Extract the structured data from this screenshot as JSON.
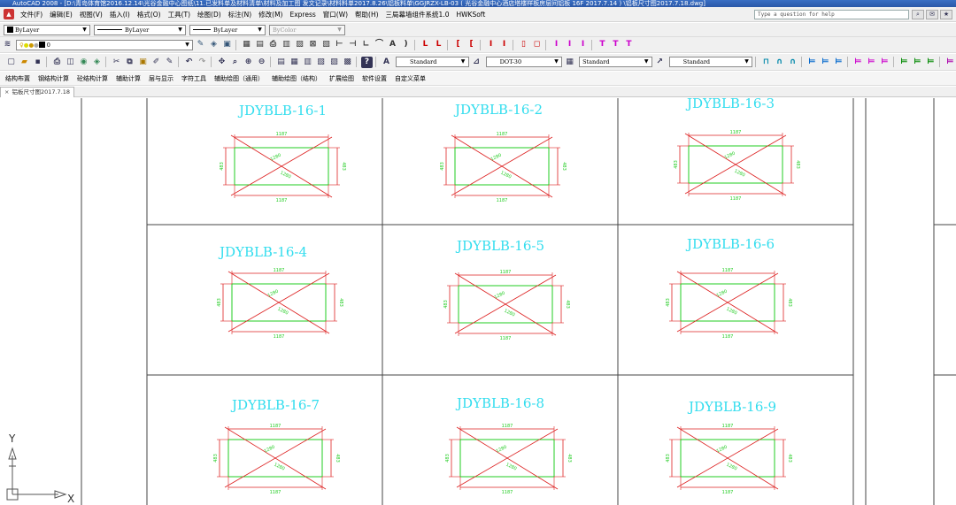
{
  "window": {
    "title": "AutoCAD 2008 - [D:\\青岛体育馆2016.12.14\\光谷金融中心图纸\\11.已发料单及材料清单\\材料及加工图 发文记录\\材料料单2017.8.26\\铝板料单\\GGJRZX-LB-03 ( 光谷金融中心酒店塔楼样板房层间铝板 16F 2017.7.14 ) \\铝板尺寸图2017.7.18.dwg]"
  },
  "menubar": {
    "items": [
      "文件(F)",
      "编辑(E)",
      "视图(V)",
      "插入(I)",
      "格式(O)",
      "工具(T)",
      "绘图(D)",
      "标注(N)",
      "修改(M)",
      "Express",
      "窗口(W)",
      "帮助(H)",
      "三局幕墙组件系统1.0",
      "HWKSoft"
    ],
    "help_placeholder": "Type a question for help"
  },
  "properties_toolbar": {
    "color": "ByLayer",
    "linetype": "ByLayer",
    "lineweight": "ByLayer",
    "plotstyle": "ByColor"
  },
  "layer_toolbar": {
    "current_layer": "0"
  },
  "styles_toolbar": {
    "text_style": "Standard",
    "dim_style": "DOT-30",
    "table_style": "Standard",
    "multileader_style": "Standard"
  },
  "custom_menu": {
    "items": [
      "结构布置",
      "钢结构计算",
      "砼结构计算",
      "辅助计算",
      "层与显示",
      "字符工具",
      "辅助绘图（通用）",
      "辅助绘图（结构）",
      "扩展绘图",
      "软件设置",
      "自定义菜单"
    ]
  },
  "document_tab": {
    "close": "×",
    "label": "铝板尺寸图2017.7.18"
  },
  "colors": {
    "title_cyan": "#33ddee",
    "panel_green": "#22cc22",
    "diagonal_red": "#dd2222"
  },
  "panels": [
    {
      "id": "JDYBLB-16-1",
      "dims": {
        "top": "1187",
        "bottom": "1187",
        "left": "483",
        "right": "483",
        "diag1": "1280",
        "diag2": "1280"
      }
    },
    {
      "id": "JDYBLB-16-2",
      "dims": {
        "top": "1187",
        "bottom": "1187",
        "left": "483",
        "right": "483",
        "diag1": "1280",
        "diag2": "1280"
      }
    },
    {
      "id": "JDYBLB-16-3",
      "dims": {
        "top": "1187",
        "bottom": "1187",
        "left": "483",
        "right": "483",
        "diag1": "1280",
        "diag2": "1280"
      }
    },
    {
      "id": "JDYBLB-16-4",
      "dims": {
        "top": "1187",
        "bottom": "1187",
        "left": "483",
        "right": "483",
        "diag1": "1280",
        "diag2": "1280"
      }
    },
    {
      "id": "JDYBLB-16-5",
      "dims": {
        "top": "1187",
        "bottom": "1187",
        "left": "483",
        "right": "483",
        "diag1": "1280",
        "diag2": "1280"
      }
    },
    {
      "id": "JDYBLB-16-6",
      "dims": {
        "top": "1187",
        "bottom": "1187",
        "left": "483",
        "right": "483",
        "diag1": "1280",
        "diag2": "1280"
      }
    },
    {
      "id": "JDYBLB-16-7",
      "dims": {
        "top": "1187",
        "bottom": "1187",
        "left": "483",
        "right": "483",
        "diag1": "1280",
        "diag2": "1280"
      }
    },
    {
      "id": "JDYBLB-16-8",
      "dims": {
        "top": "1187",
        "bottom": "1187",
        "left": "483",
        "right": "483",
        "diag1": "1280",
        "diag2": "1280"
      }
    },
    {
      "id": "JDYBLB-16-9",
      "dims": {
        "top": "1187",
        "bottom": "1187",
        "left": "483",
        "right": "483",
        "diag1": "1280",
        "diag2": "1280"
      }
    }
  ],
  "ucs": {
    "y_label": "Y",
    "x_label": "X"
  }
}
